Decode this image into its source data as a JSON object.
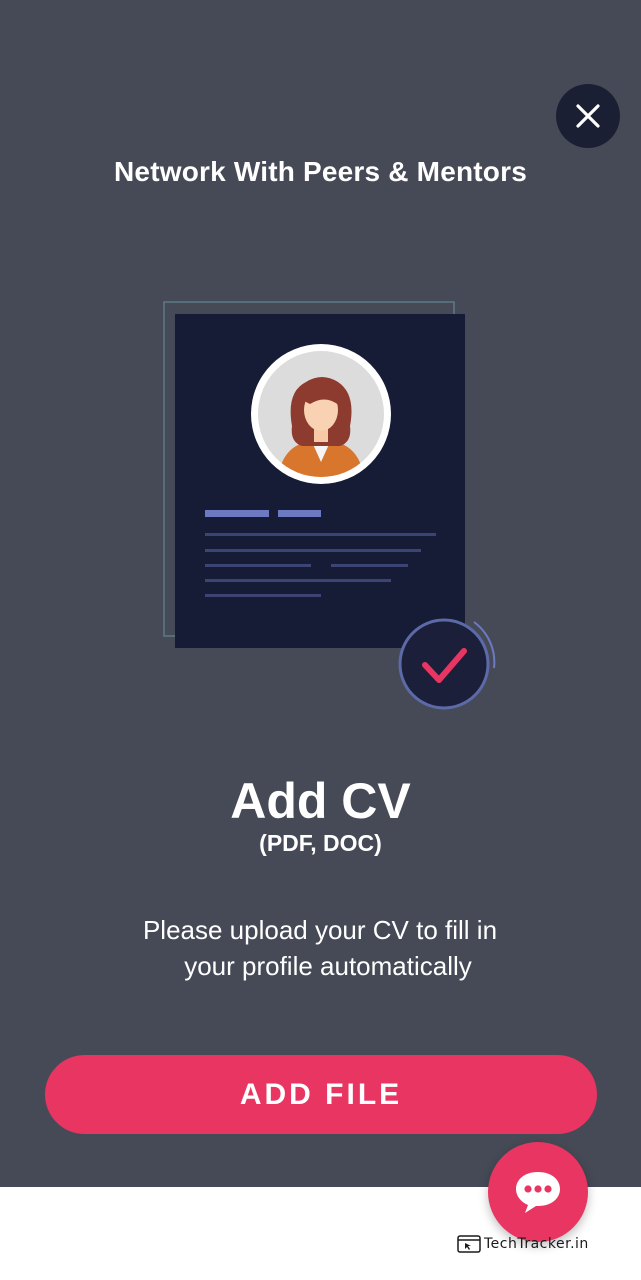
{
  "modal": {
    "title": "Network With Peers & Mentors",
    "heading": "Add CV",
    "subheading": "(PDF, DOC)",
    "description_line1": "Please upload your CV to fill in",
    "description_line2": "your profile automatically",
    "add_file_label": "ADD FILE"
  },
  "icons": {
    "close": "close-icon",
    "chat": "chat-bubble-icon",
    "check": "checkmark-icon"
  },
  "colors": {
    "modal_bg": "#464a56",
    "accent": "#e83561",
    "dark_navy": "#1b1f34"
  },
  "watermark": {
    "text": "TechTracker.in"
  }
}
